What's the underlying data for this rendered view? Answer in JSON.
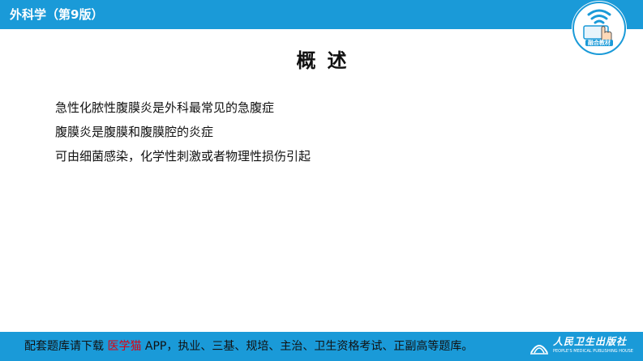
{
  "header": {
    "title": "外科学（第9版）",
    "logo_caption": "融合教材"
  },
  "slide": {
    "heading": "概述",
    "bullets": [
      "急性化脓性腹膜炎是外科最常见的急腹症",
      "腹膜炎是腹膜和腹膜腔的炎症",
      "可由细菌感染，化学性刺激或者物理性损伤引起"
    ]
  },
  "footer": {
    "text_before": "配套题库请下载 ",
    "highlight": "医学猫",
    "text_after": " APP，执业、三基、规培、主治、卫生资格考试、正副高等题库。",
    "publisher_cn": "人民卫生出版社",
    "publisher_en": "PEOPLE'S MEDICAL PUBLISHING HOUSE"
  },
  "colors": {
    "bar": "#1a9ad8",
    "highlight": "#e00010",
    "text": "#111111"
  }
}
